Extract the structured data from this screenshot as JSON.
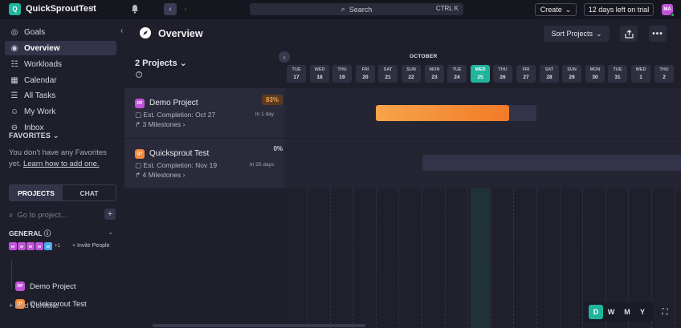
{
  "topbar": {
    "workspace_initial": "Q",
    "workspace_name": "QuickSproutTest",
    "search_label": "Search",
    "search_shortcut": "CTRL K",
    "create_label": "Create",
    "trial_label": "12 days left on trial",
    "user_initials": "MA"
  },
  "sidebar": {
    "items": [
      {
        "label": "Goals",
        "icon": "target-icon"
      },
      {
        "label": "Overview",
        "icon": "compass-icon"
      },
      {
        "label": "Workloads",
        "icon": "workload-icon"
      },
      {
        "label": "Calendar",
        "icon": "calendar-icon"
      },
      {
        "label": "All Tasks",
        "icon": "list-icon"
      },
      {
        "label": "My Work",
        "icon": "user-circle-icon"
      },
      {
        "label": "Inbox",
        "icon": "inbox-icon"
      }
    ],
    "favorites_heading": "FAVORITES",
    "favorites_text": "You don't have any Favorites yet.",
    "favorites_link": "Learn how to add one.",
    "tab_projects": "PROJECTS",
    "tab_chat": "CHAT",
    "goto_placeholder": "Go to project...",
    "general_heading": "GENERAL",
    "member_count": "+1",
    "invite_label": "+ Invite People",
    "projects": [
      {
        "label": "Demo Project",
        "initials": "DP",
        "color": "#c054d8"
      },
      {
        "label": "Quicksprout Test",
        "initials": "QT",
        "color": "#f2873a"
      }
    ],
    "add_portfolio": "+ Add Portfolio"
  },
  "header": {
    "title": "Overview",
    "sort_label": "Sort Projects"
  },
  "project_list": {
    "count_label": "2 Projects",
    "rows": [
      {
        "initials": "DP",
        "color": "#c054d8",
        "name": "Demo Project",
        "est": "Est. Completion: Oct 27",
        "milestones": "3 Milestones",
        "percent": "83%",
        "due": "In 1 day",
        "progress": 0.83
      },
      {
        "initials": "QT",
        "color": "#f2873a",
        "name": "Quicksprout Test",
        "est": "Est. Completion: Nov 19",
        "milestones": "4 Milestones",
        "percent": "0%",
        "due": "In 25 days",
        "progress": 0.0
      }
    ]
  },
  "timeline": {
    "month": "OCTOBER",
    "days": [
      {
        "w": "TUE",
        "n": "17"
      },
      {
        "w": "WED",
        "n": "18"
      },
      {
        "w": "THU",
        "n": "19"
      },
      {
        "w": "FRI",
        "n": "20"
      },
      {
        "w": "SAT",
        "n": "21"
      },
      {
        "w": "SUN",
        "n": "22"
      },
      {
        "w": "MON",
        "n": "23"
      },
      {
        "w": "TUE",
        "n": "24"
      },
      {
        "w": "WED",
        "n": "25",
        "today": true
      },
      {
        "w": "THU",
        "n": "26"
      },
      {
        "w": "FRI",
        "n": "27"
      },
      {
        "w": "SAT",
        "n": "28"
      },
      {
        "w": "SUN",
        "n": "29"
      },
      {
        "w": "MON",
        "n": "30"
      },
      {
        "w": "TUE",
        "n": "31"
      },
      {
        "w": "WED",
        "n": "1"
      },
      {
        "w": "THU",
        "n": "2"
      }
    ],
    "scales": [
      "D",
      "W",
      "M",
      "Y"
    ],
    "active_scale": "D",
    "accent": "#1fb59d"
  }
}
